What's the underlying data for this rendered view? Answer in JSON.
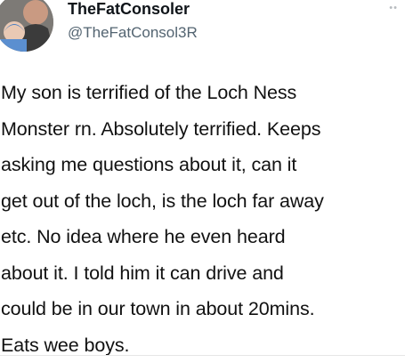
{
  "tweet": {
    "display_name": "TheFatConsoler",
    "handle": "@TheFatConsol3R",
    "more_icon": "more-horizontal-icon",
    "text": "My son is terrified of the Loch Ness\nMonster rn. Absolutely terrified. Keeps\nasking me questions about it, can it\nget out of the loch, is the loch far away\netc. No idea where he even heard\nabout it. I told him it can drive and\ncould be in our town in about 20mins.\nEats wee boys."
  },
  "colors": {
    "handle": "#536471",
    "text": "#111111",
    "background": "#ffffff"
  }
}
